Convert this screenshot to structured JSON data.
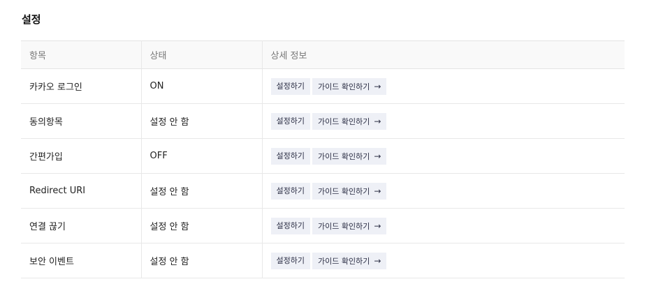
{
  "section": {
    "title": "설정"
  },
  "table": {
    "headers": [
      "항목",
      "상태",
      "상세 정보"
    ],
    "rows": [
      {
        "item": "카카오 로그인",
        "status": "ON",
        "setup_label": "설정하기",
        "guide_label": "가이드 확인하기"
      },
      {
        "item": "동의항목",
        "status": "설정 안 함",
        "setup_label": "설정하기",
        "guide_label": "가이드 확인하기"
      },
      {
        "item": "간편가입",
        "status": "OFF",
        "setup_label": "설정하기",
        "guide_label": "가이드 확인하기"
      },
      {
        "item": "Redirect URI",
        "status": "설정 안 함",
        "setup_label": "설정하기",
        "guide_label": "가이드 확인하기"
      },
      {
        "item": "연결 끊기",
        "status": "설정 안 함",
        "setup_label": "설정하기",
        "guide_label": "가이드 확인하기"
      },
      {
        "item": "보안 이벤트",
        "status": "설정 안 함",
        "setup_label": "설정하기",
        "guide_label": "가이드 확인하기"
      }
    ]
  },
  "icons": {
    "guide_arrow": "arrow-right-icon"
  },
  "colors": {
    "button_bg": "#eef0f6",
    "button_text": "#2c2f45",
    "header_bg": "#f9f9f9",
    "border": "#e8e8e8"
  }
}
